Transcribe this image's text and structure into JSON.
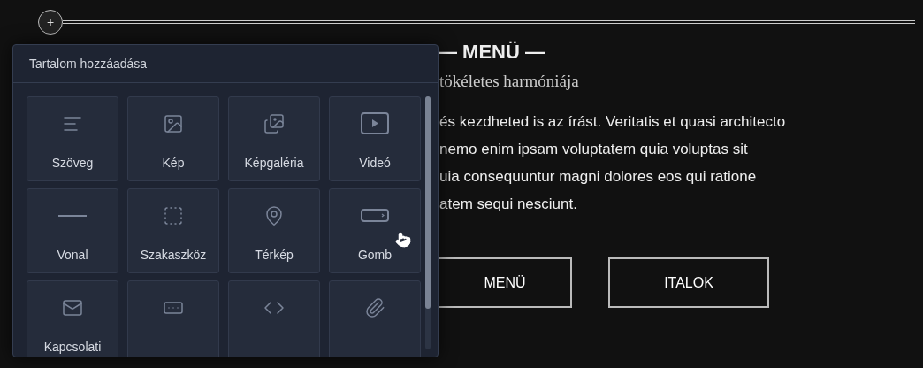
{
  "add_button": {
    "label": "+"
  },
  "page": {
    "heading": "— MENÜ —",
    "subtitle": "tökéletes harmóniája",
    "paragraph_lines": [
      "és kezdheted is az írást. Veritatis et quasi architecto",
      "nemo enim ipsam voluptatem quia voluptas sit",
      "uia consequuntur magni dolores eos qui ratione",
      "atem sequi nesciunt."
    ],
    "buttons": [
      "MENÜ",
      "ITALOK"
    ]
  },
  "popup": {
    "title": "Tartalom hozzáadása",
    "items": [
      {
        "label": "Szöveg",
        "kind": "tile"
      },
      {
        "label": "Kép",
        "kind": "tile"
      },
      {
        "label": "Képgaléria",
        "kind": "tile"
      },
      {
        "label": "Videó",
        "kind": "tile"
      },
      {
        "label": "Vonal",
        "kind": "tile"
      },
      {
        "label": "Szakaszköz",
        "kind": "tile"
      },
      {
        "label": "Térkép",
        "kind": "tile"
      },
      {
        "label": "Gomb",
        "kind": "tile"
      },
      {
        "label": "Kapcsolati",
        "kind": "tile"
      },
      {
        "kind": "tile"
      },
      {
        "kind": "tile"
      },
      {
        "kind": "tile"
      }
    ]
  }
}
